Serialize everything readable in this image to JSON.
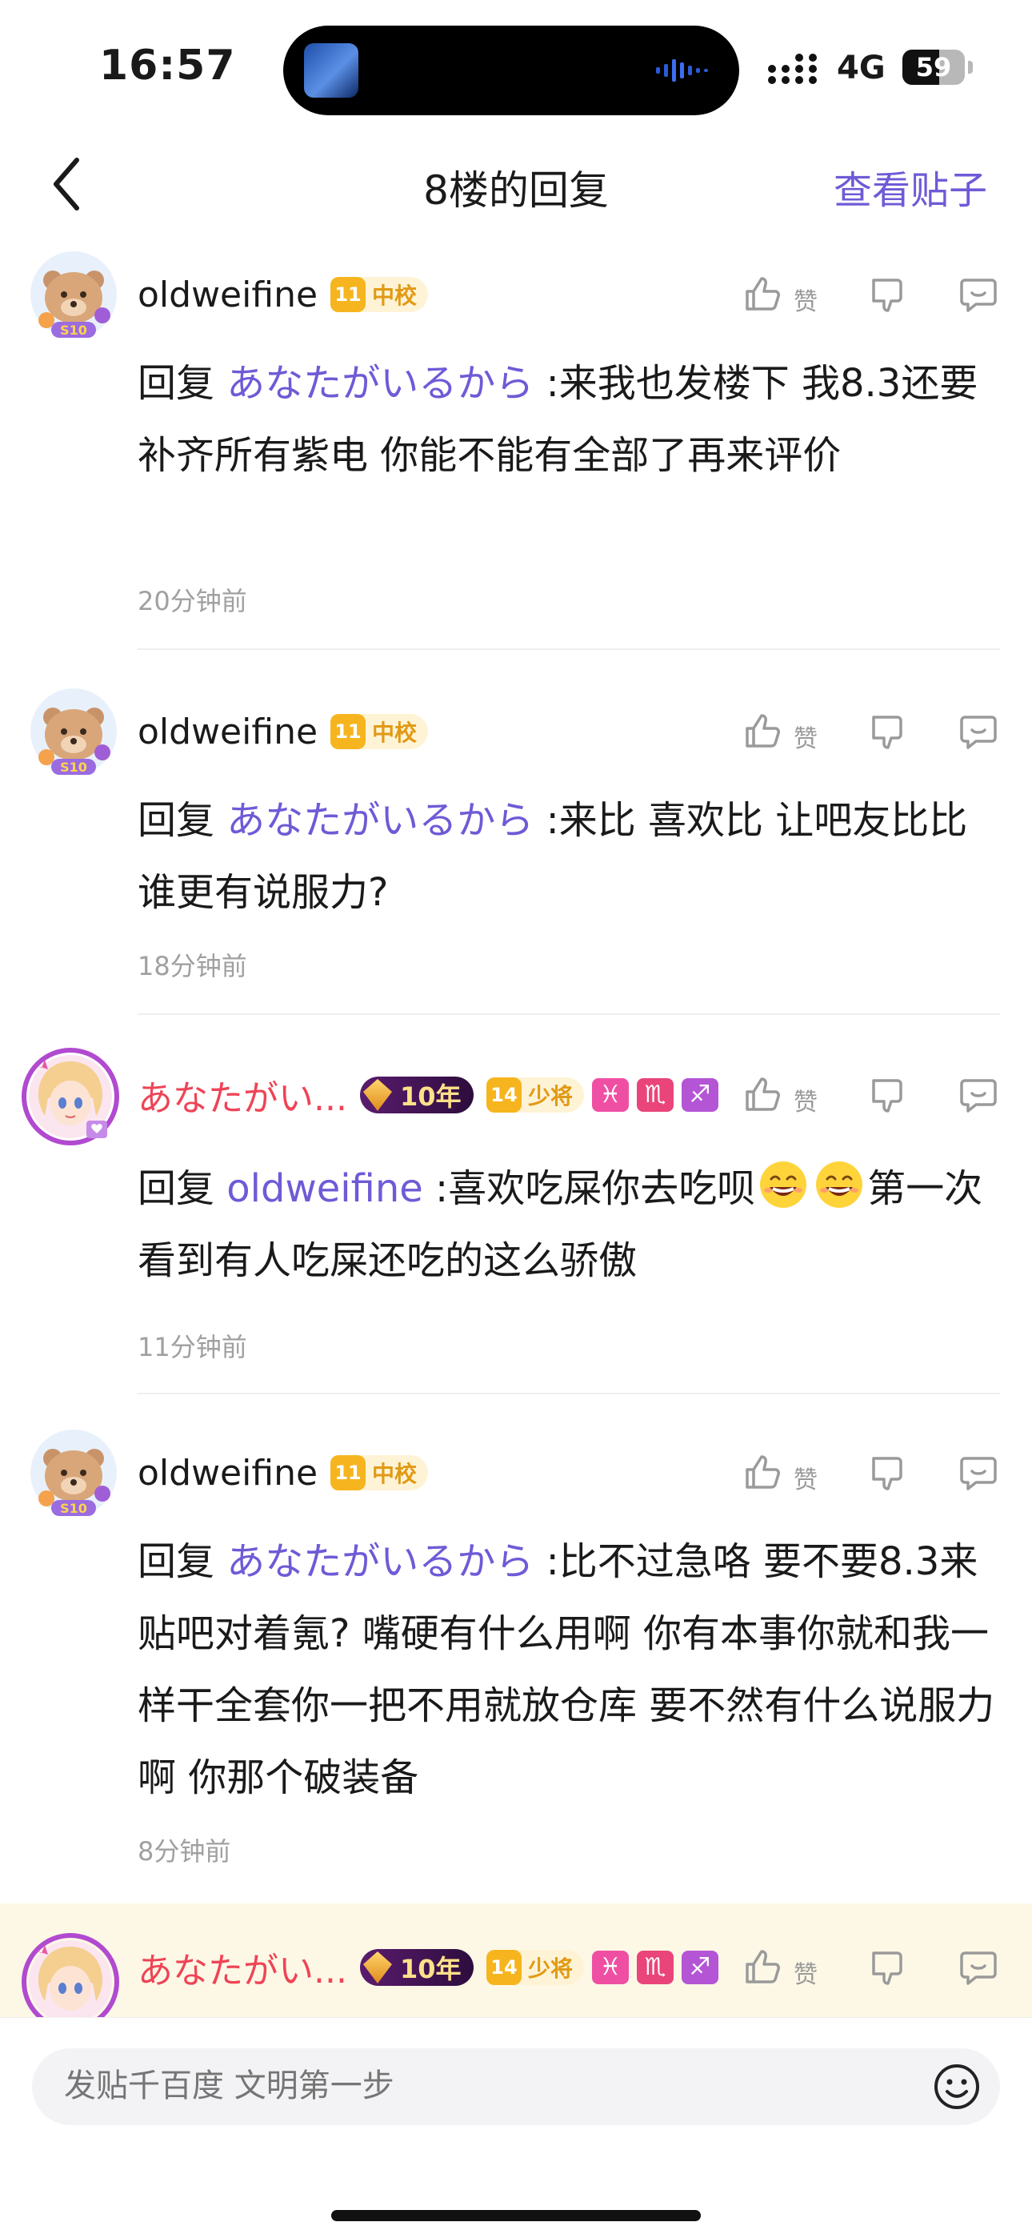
{
  "status_bar": {
    "time": "16:57",
    "network": "4G",
    "battery": "59",
    "battery_level": 0.59
  },
  "nav": {
    "title": "8楼的回复",
    "view_post": "查看贴子"
  },
  "actions": {
    "like_label": "赞"
  },
  "comments": [
    {
      "username": "oldweifine",
      "level": "11",
      "rank": "中校",
      "avatar_icon": "bear-avatar",
      "avatar_badge": "S10",
      "reply_prefix": "回复",
      "mention": "あなたがいるから",
      "text": ":来我也发楼下 我8.3还要补齐所有紫电 你能不能有全部了再来评价",
      "time": "20分钟前"
    },
    {
      "username": "oldweifine",
      "level": "11",
      "rank": "中校",
      "avatar_icon": "bear-avatar",
      "avatar_badge": "S10",
      "reply_prefix": "回复",
      "mention": "あなたがいるから",
      "text": ":来比 喜欢比 让吧友比比谁更有说服力?",
      "time": "18分钟前"
    },
    {
      "username": "あなたがい...",
      "years": "10年",
      "level": "14",
      "rank": "少将",
      "zodiac": [
        "♓",
        "♏",
        "♐"
      ],
      "avatar_icon": "anime-girl-avatar",
      "reply_prefix": "回复",
      "mention": "oldweifine",
      "text_a": ":喜欢吃屎你去吃呗",
      "text_b": "第一次看到有人吃屎还吃的这么骄傲",
      "emoji": "grinning-face-icon",
      "time": "11分钟前"
    },
    {
      "username": "oldweifine",
      "level": "11",
      "rank": "中校",
      "avatar_icon": "bear-avatar",
      "avatar_badge": "S10",
      "reply_prefix": "回复",
      "mention": "あなたがいるから",
      "text": ":比不过急咯 要不要8.3来贴吧对着氪? 嘴硬有什么用啊 你有本事你就和我一样干全套你一把不用就放仓库 要不然有什么说服力啊 你那个破装备",
      "time": "8分钟前"
    },
    {
      "username": "あなたがい...",
      "years": "10年",
      "level": "14",
      "rank": "少将",
      "zodiac": [
        "♓",
        "♏",
        "♐"
      ],
      "avatar_icon": "anime-girl-avatar"
    }
  ],
  "input": {
    "placeholder": "发贴千百度 文明第一步"
  },
  "colors": {
    "accent": "#6f5ad6",
    "username_red": "#ee4456",
    "highlight_bg": "#fdf8e6",
    "rank_gold": "#e19a15"
  }
}
